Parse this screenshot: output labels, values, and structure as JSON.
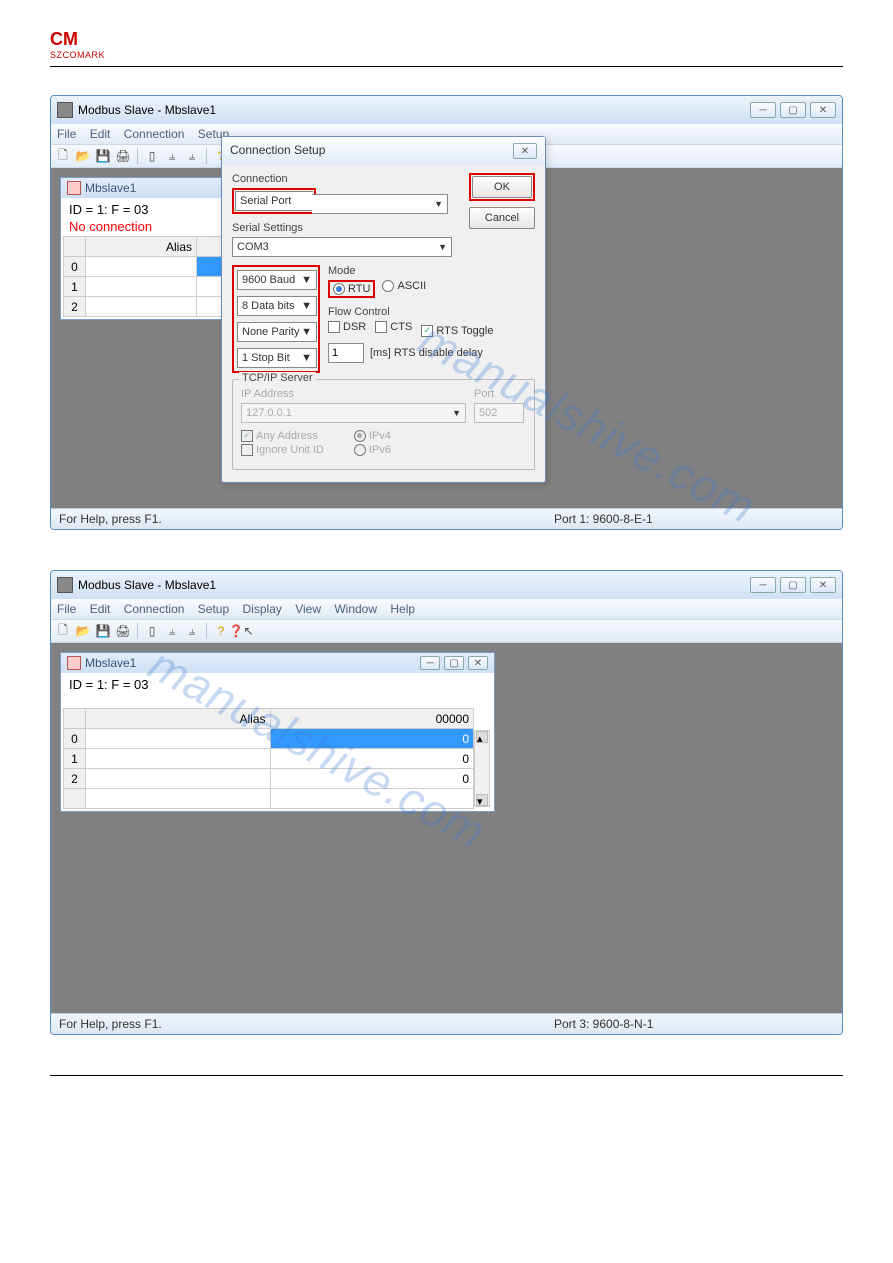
{
  "logo": {
    "top": "CM",
    "sub": "SZCOMARK"
  },
  "s1": {
    "title": "Modbus Slave - Mbslave1",
    "menus": [
      "File",
      "Edit",
      "Connection",
      "Setup"
    ],
    "inner": {
      "title": "Mbslave1",
      "idline": "ID = 1: F = 03",
      "noconn": "No connection",
      "aliasHeader": "Alias",
      "rows": [
        "0",
        "1",
        "2"
      ]
    },
    "status": {
      "left": "For Help, press F1.",
      "right": "Port 1: 9600-8-E-1"
    }
  },
  "dlg": {
    "title": "Connection Setup",
    "ok": "OK",
    "cancel": "Cancel",
    "connectionLabel": "Connection",
    "connectionValue": "Serial Port",
    "serialSettingsLabel": "Serial Settings",
    "com": "COM3",
    "baud": "9600 Baud",
    "databits": "8 Data bits",
    "parity": "None Parity",
    "stopbit": "1 Stop Bit",
    "modeLabel": "Mode",
    "rtu": "RTU",
    "ascii": "ASCII",
    "flowLabel": "Flow Control",
    "dsr": "DSR",
    "cts": "CTS",
    "rts": "RTS Toggle",
    "msDelay": "1",
    "msDelayLabel": "[ms] RTS disable delay",
    "tcpLabel": "TCP/IP Server",
    "ipLabel": "IP Address",
    "ip": "127.0.0.1",
    "portLabel": "Port",
    "port": "502",
    "anyAddr": "Any Address",
    "ignoreUnit": "Ignore Unit ID",
    "ipv4": "IPv4",
    "ipv6": "IPv6"
  },
  "s2": {
    "title": "Modbus Slave - Mbslave1",
    "menus": [
      "File",
      "Edit",
      "Connection",
      "Setup",
      "Display",
      "View",
      "Window",
      "Help"
    ],
    "inner": {
      "title": "Mbslave1",
      "idline": "ID = 1: F = 03",
      "aliasHeader": "Alias",
      "colHeader": "00000",
      "rows": [
        {
          "h": "0",
          "v": "0",
          "sel": true
        },
        {
          "h": "1",
          "v": "0"
        },
        {
          "h": "2",
          "v": "0"
        }
      ]
    },
    "status": {
      "left": "For Help, press F1.",
      "right": "Port 3: 9600-8-N-1"
    }
  },
  "watermark": "manualshive.com"
}
